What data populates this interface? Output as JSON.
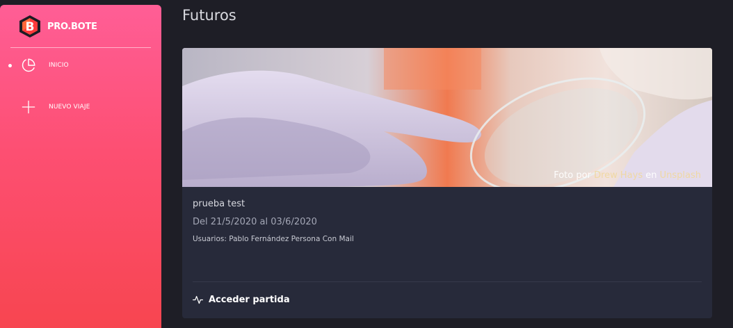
{
  "brand": {
    "name": "PRO.BOTE",
    "logo_letter": "B"
  },
  "nav": {
    "items": [
      {
        "label": "INICIO",
        "icon": "pie-chart-icon",
        "active": true
      },
      {
        "label": "NUEVO VIAJE",
        "icon": "plus-icon",
        "active": false
      }
    ]
  },
  "page": {
    "title": "Futuros"
  },
  "trip_card": {
    "photo_credit": {
      "prefix": "Foto por ",
      "author": "Drew Hays",
      "middle": " en ",
      "site": "Unsplash"
    },
    "name": "prueba test",
    "dates": "Del 21/5/2020 al 03/6/2020",
    "users": "Usuarios: Pablo Fernández Persona Con Mail",
    "action_label": "Acceder partida",
    "action_icon": "activity-icon"
  },
  "colors": {
    "sidebar_top": "#ff5e96",
    "sidebar_bottom": "#f7454f",
    "background": "#1e1e26",
    "card": "#272a3a"
  }
}
